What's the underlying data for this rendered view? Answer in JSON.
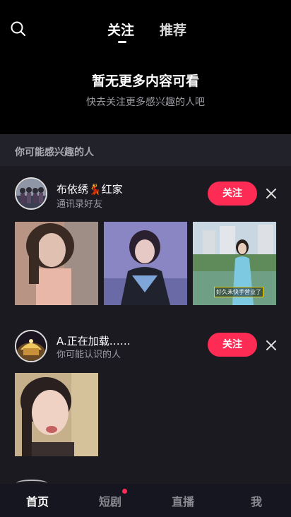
{
  "header": {
    "tabs": [
      {
        "label": "关注",
        "active": true
      },
      {
        "label": "推荐",
        "active": false
      }
    ]
  },
  "empty_state": {
    "title": "暂无更多内容可看",
    "subtitle": "快去关注更多感兴趣的人吧"
  },
  "suggestions": {
    "section_title": "你可能感兴趣的人",
    "users": [
      {
        "name": "布依绣💃红家",
        "reason": "通讯录好友",
        "follow_label": "关注",
        "thumbnails": [
          {
            "caption": ""
          },
          {
            "caption": ""
          },
          {
            "caption": "好久未快手营业了"
          }
        ]
      },
      {
        "name": "A.正在加载……",
        "reason": "你可能认识的人",
        "follow_label": "关注",
        "thumbnails": [
          {
            "caption": ""
          }
        ]
      }
    ]
  },
  "bottom_nav": {
    "items": [
      {
        "label": "首页",
        "active": true
      },
      {
        "label": "短剧",
        "badge": true
      },
      {
        "label": "直播"
      },
      {
        "label": "我"
      }
    ]
  },
  "colors": {
    "accent": "#fe2c55",
    "background": "#1b1a21",
    "header_bg": "#000000"
  }
}
